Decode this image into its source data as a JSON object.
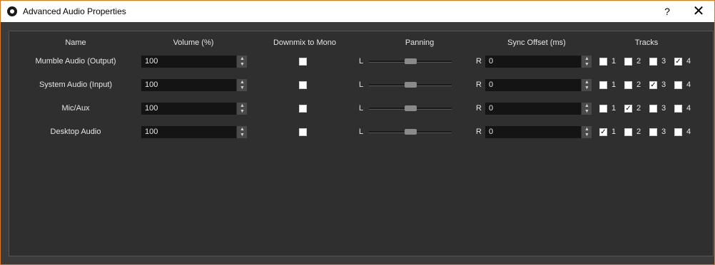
{
  "window": {
    "title": "Advanced Audio Properties",
    "help_label": "?",
    "close_label": "✕"
  },
  "headers": {
    "name": "Name",
    "volume": "Volume (%)",
    "downmix": "Downmix to Mono",
    "panning": "Panning",
    "sync": "Sync Offset (ms)",
    "tracks": "Tracks"
  },
  "panning_labels": {
    "left": "L",
    "right": "R"
  },
  "rows": [
    {
      "name": "Mumble Audio (Output)",
      "volume": "100",
      "mono": false,
      "pan": 0.5,
      "sync": "0",
      "tracks": [
        {
          "label": "1",
          "checked": false
        },
        {
          "label": "2",
          "checked": false
        },
        {
          "label": "3",
          "checked": false
        },
        {
          "label": "4",
          "checked": true
        }
      ]
    },
    {
      "name": "System Audio (Input)",
      "volume": "100",
      "mono": false,
      "pan": 0.5,
      "sync": "0",
      "tracks": [
        {
          "label": "1",
          "checked": false
        },
        {
          "label": "2",
          "checked": false
        },
        {
          "label": "3",
          "checked": true
        },
        {
          "label": "4",
          "checked": false
        }
      ]
    },
    {
      "name": "Mic/Aux",
      "volume": "100",
      "mono": false,
      "pan": 0.5,
      "sync": "0",
      "tracks": [
        {
          "label": "1",
          "checked": false
        },
        {
          "label": "2",
          "checked": true
        },
        {
          "label": "3",
          "checked": false
        },
        {
          "label": "4",
          "checked": false
        }
      ]
    },
    {
      "name": "Desktop Audio",
      "volume": "100",
      "mono": false,
      "pan": 0.5,
      "sync": "0",
      "tracks": [
        {
          "label": "1",
          "checked": true
        },
        {
          "label": "2",
          "checked": false
        },
        {
          "label": "3",
          "checked": false
        },
        {
          "label": "4",
          "checked": false
        }
      ]
    }
  ],
  "colors": {
    "accent_border": "#e9730f",
    "background": "#3b3b3b",
    "panel": "#2f2f2f",
    "input_bg": "#141414"
  }
}
